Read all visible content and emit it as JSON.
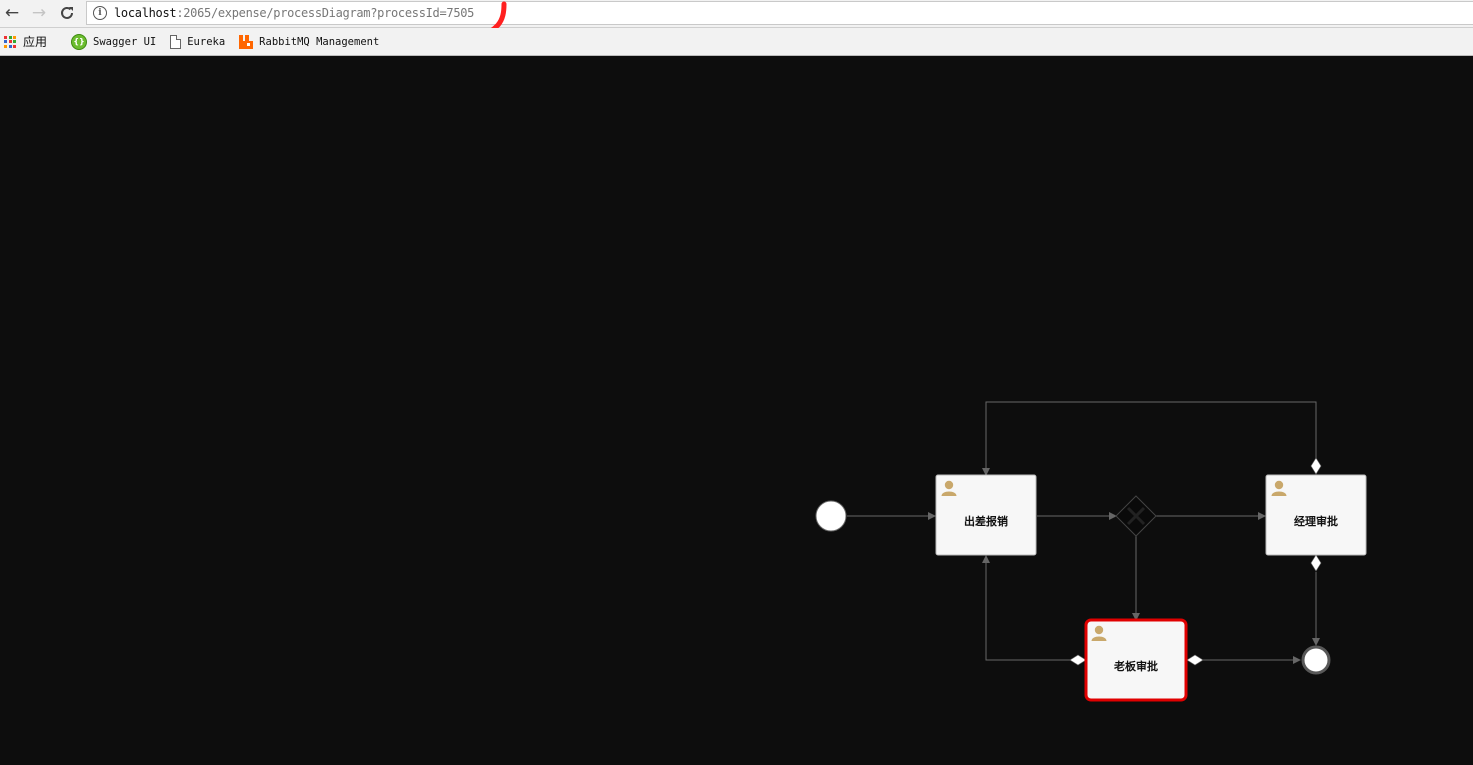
{
  "browser": {
    "url_host": "localhost",
    "url_path": ":2065/expense/processDiagram?processId=7505"
  },
  "bookmarks": [
    {
      "label": "应用",
      "icon": "apps-grid-icon"
    },
    {
      "label": "Swagger UI",
      "icon": "swagger-icon"
    },
    {
      "label": "Eureka",
      "icon": "page-icon"
    },
    {
      "label": "RabbitMQ Management",
      "icon": "rabbitmq-icon"
    }
  ],
  "diagram": {
    "tasks": [
      {
        "id": "submit",
        "label": "出差报销",
        "active": false
      },
      {
        "id": "manager",
        "label": "经理审批",
        "active": false
      },
      {
        "id": "boss",
        "label": "老板审批",
        "active": true
      }
    ],
    "colors": {
      "active_border": "#e00000",
      "task_fill": "#f7f7f7",
      "flow_line": "#666666",
      "user_icon": "#c9a86b"
    }
  }
}
